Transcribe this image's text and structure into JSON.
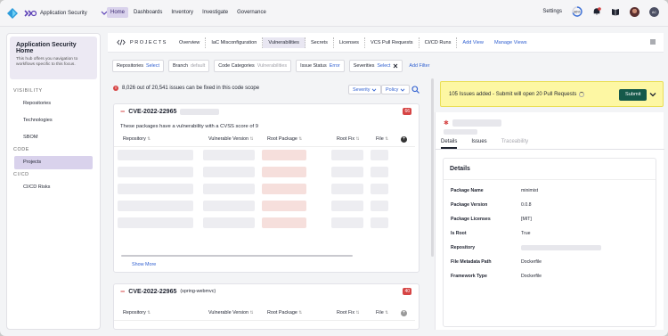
{
  "nav": {
    "app_name": "Application Security",
    "tabs": [
      {
        "label": "Home",
        "active": true
      },
      {
        "label": "Dashboards",
        "active": false
      },
      {
        "label": "Inventory",
        "active": false
      },
      {
        "label": "Investigate",
        "active": false
      },
      {
        "label": "Governance",
        "active": false
      }
    ],
    "settings_label": "Settings",
    "score_label": "86%",
    "avatar_initials": "AC"
  },
  "sidebar": {
    "title": "Application Security Home",
    "description": "This hub offers you navigation to workflows specific to this focus.",
    "sections": [
      {
        "label": "VISIBILITY",
        "items": [
          "Repositories",
          "Technologies",
          "SBOM"
        ]
      },
      {
        "label": "CODE",
        "items": [
          "Projects"
        ]
      },
      {
        "label": "CI/CD",
        "items": [
          "CI/CD Risks"
        ]
      }
    ],
    "active_item": "Projects"
  },
  "subbar": {
    "section_label": "PROJECTS",
    "tabs": [
      "Overview",
      "IaC Misconfiguration",
      "Vulnerabilities",
      "Secrets",
      "Licenses",
      "VCS Pull Requests",
      "CI/CD Runs"
    ],
    "active_tab": "Vulnerabilities",
    "add_view": "Add View",
    "manage_views": "Manage Views"
  },
  "filters": [
    {
      "label": "Repositories",
      "value": "Select"
    },
    {
      "label": "Branch",
      "value": "default"
    },
    {
      "label": "Code Categories",
      "value": "Vulnerabilities"
    },
    {
      "label": "Issue Status",
      "value": "Error"
    },
    {
      "label": "Severities",
      "value": "Select"
    }
  ],
  "add_filter": "Add Filter",
  "summary": "8,026 out of 20,541 issues can be fixed in this code scope",
  "severity_select": "Severity",
  "policy_select": "Policy",
  "cards": [
    {
      "cve": "CVE-2022-22965",
      "subtitle": "",
      "badge": "66",
      "description": "These packages have a vulnerability with a CVSS score of 9",
      "columns": [
        "Repository",
        "Vulnerable Version",
        "Root Package",
        "Root Fix",
        "File"
      ],
      "show_more": "Show More"
    },
    {
      "cve": "CVE-2022-22965",
      "subtitle": "(spring-webmvc)",
      "badge": "40",
      "columns": [
        "Repository",
        "Vulnerable Version",
        "Root Package",
        "Root Fix",
        "File"
      ]
    }
  ],
  "banner": {
    "text": "105 Issues added - Submit will open 20 Pull Requests",
    "submit_label": "Submit"
  },
  "detail_panel": {
    "tabs": [
      "Details",
      "Issues",
      "Traceability"
    ],
    "active_tab": "Details",
    "title": "Details",
    "fields": [
      {
        "key": "Package Name",
        "value": "minimist"
      },
      {
        "key": "Package Version",
        "value": "0.0.8"
      },
      {
        "key": "Package Licenses",
        "value": "[MIT]"
      },
      {
        "key": "Is Root",
        "value": "True"
      },
      {
        "key": "Repository",
        "value": ""
      },
      {
        "key": "File Metadata Path",
        "value": "Dockerfile"
      },
      {
        "key": "Framework Type",
        "value": "Dockerfile"
      }
    ]
  },
  "colors": {
    "accent": "#d9d2ec",
    "link": "#2f5fd0",
    "danger": "#d64545",
    "banner_bg": "#fdf7a3",
    "submit_bg": "#15594a"
  }
}
